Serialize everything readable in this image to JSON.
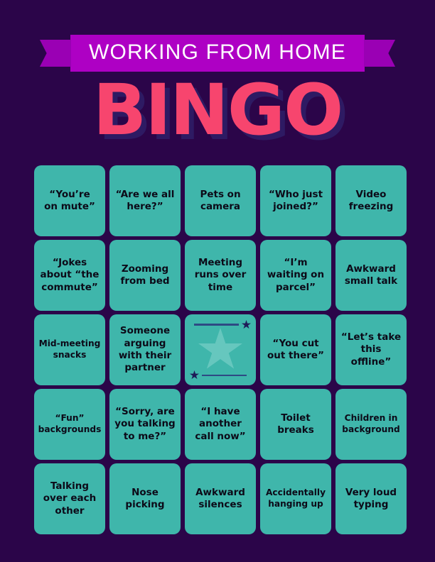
{
  "colors": {
    "background": "#2B0549",
    "ribbon_body": "#AE00C4",
    "ribbon_tail": "#9A00B4",
    "bingo_pink": "#F7456E",
    "bingo_shadow": "#2E1A63",
    "cell_teal": "#3FB6AB",
    "cell_text": "#0C0A18",
    "star_light": "#66C7BE",
    "star_navy": "#1F1B58",
    "rule_navy": "#2E4A84"
  },
  "header": {
    "banner_title": "WORKING FROM HOME",
    "bingo_title": "BINGO"
  },
  "grid": {
    "rows": 5,
    "columns": 5,
    "cells": [
      {
        "text": "“You’re\non mute”",
        "type": "text"
      },
      {
        "text": "“Are we all\nhere?”",
        "type": "text"
      },
      {
        "text": "Pets on\ncamera",
        "type": "text"
      },
      {
        "text": "“Who just\njoined?”",
        "type": "text"
      },
      {
        "text": "Video\nfreezing",
        "type": "text"
      },
      {
        "text": "“Jokes\nabout “the\ncommute”",
        "type": "text"
      },
      {
        "text": "Zooming\nfrom bed",
        "type": "text"
      },
      {
        "text": "Meeting\nruns over\ntime",
        "type": "text"
      },
      {
        "text": "“I’m\nwaiting on\nparcel”",
        "type": "text"
      },
      {
        "text": "Awkward\nsmall talk",
        "type": "text"
      },
      {
        "text": "Mid-meeting\nsnacks",
        "type": "text",
        "small": true
      },
      {
        "text": "Someone\narguing\nwith their\npartner",
        "type": "text"
      },
      {
        "text": "",
        "type": "free"
      },
      {
        "text": "“You cut\nout there”",
        "type": "text"
      },
      {
        "text": "“Let’s take\nthis\noffline”",
        "type": "text"
      },
      {
        "text": "“Fun”\nbackgrounds",
        "type": "text",
        "small": true
      },
      {
        "text": "“Sorry, are\nyou talking\nto me?”",
        "type": "text"
      },
      {
        "text": "“I have\nanother\ncall now”",
        "type": "text"
      },
      {
        "text": "Toilet\nbreaks",
        "type": "text"
      },
      {
        "text": "Children in\nbackground",
        "type": "text",
        "small": true
      },
      {
        "text": "Talking\nover each\nother",
        "type": "text"
      },
      {
        "text": "Nose\npicking",
        "type": "text"
      },
      {
        "text": "Awkward\nsilences",
        "type": "text"
      },
      {
        "text": "Accidentally\nhanging up",
        "type": "text",
        "small": true
      },
      {
        "text": "Very loud\ntyping",
        "type": "text"
      }
    ]
  },
  "free_space": {
    "icons": {
      "center": "star-icon",
      "top_right": "star-icon",
      "bottom_left": "star-icon"
    }
  }
}
